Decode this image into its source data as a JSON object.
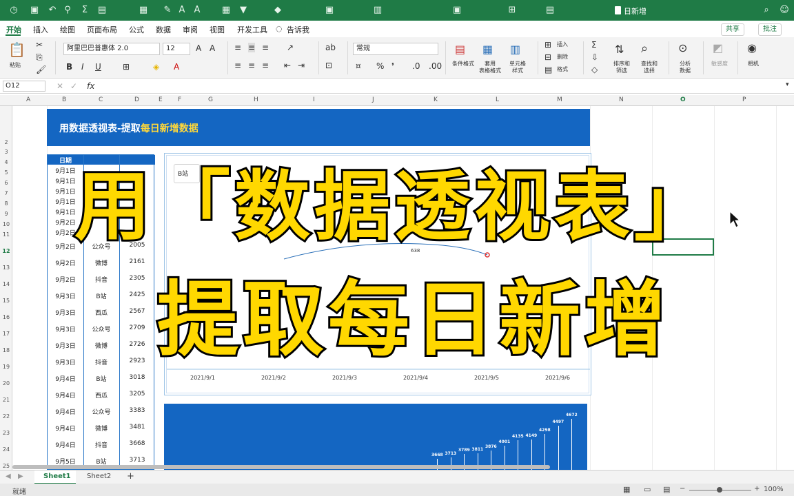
{
  "window": {
    "title": "日新增"
  },
  "tabs": [
    "开始",
    "插入",
    "绘图",
    "页面布局",
    "公式",
    "数据",
    "审阅",
    "视图",
    "开发工具",
    "告诉我"
  ],
  "top_buttons": {
    "share": "共享",
    "comment": "批注"
  },
  "ribbon": {
    "paste": "粘贴",
    "font_name": "阿里巴巴普惠体 2.0",
    "font_size": "12",
    "bold": "B",
    "italic": "I",
    "underline": "U",
    "number_format": "常规",
    "cond_format": "条件格式",
    "table_format": "套用\n表格格式",
    "cell_style": "单元格\n样式",
    "insert": "插入",
    "delete": "删除",
    "format": "格式",
    "sort_filter": "排序和\n筛选",
    "find_select": "查找和\n选择",
    "analyze": "分析\n数据",
    "sensitivity": "敏感度",
    "camera": "相机",
    "fx": "fx"
  },
  "name_box": "O12",
  "columns": [
    "A",
    "B",
    "C",
    "D",
    "E",
    "F",
    "G",
    "H",
    "I",
    "J",
    "K",
    "L",
    "M",
    "N",
    "O",
    "P"
  ],
  "rows": [
    "2",
    "3",
    "4",
    "5",
    "6",
    "7",
    "8",
    "9",
    "10",
    "11",
    "12",
    "13",
    "14",
    "15",
    "16",
    "17",
    "18",
    "19",
    "20",
    "21",
    "22",
    "23",
    "24",
    "25"
  ],
  "banner": {
    "prefix": "用数据透视表-提取",
    "highlight": "每日新增数据"
  },
  "table": {
    "header_date": "日期",
    "rows": [
      [
        "9月1日",
        "",
        ""
      ],
      [
        "9月1日",
        "",
        ""
      ],
      [
        "9月1日",
        "",
        ""
      ],
      [
        "9月1日",
        "",
        ""
      ],
      [
        "9月1日",
        "",
        ""
      ],
      [
        "9月2日",
        "",
        ""
      ],
      [
        "9月2日",
        "",
        ""
      ],
      [
        "9月2日",
        "公众号",
        "2005"
      ],
      [
        "9月2日",
        "微博",
        "2161"
      ],
      [
        "9月2日",
        "抖音",
        "2305"
      ],
      [
        "9月3日",
        "B站",
        "2425"
      ],
      [
        "9月3日",
        "西瓜",
        "2567"
      ],
      [
        "9月3日",
        "公众号",
        "2709"
      ],
      [
        "9月3日",
        "微博",
        "2726"
      ],
      [
        "9月3日",
        "抖音",
        "2923"
      ],
      [
        "9月4日",
        "B站",
        "3018"
      ],
      [
        "9月4日",
        "西瓜",
        "3205"
      ],
      [
        "9月4日",
        "公众号",
        "3383"
      ],
      [
        "9月4日",
        "微博",
        "3481"
      ],
      [
        "9月4日",
        "抖音",
        "3668"
      ],
      [
        "9月5日",
        "B站",
        "3713"
      ]
    ]
  },
  "chart1": {
    "filter_label": "B站",
    "point_label": "638",
    "x_labels": [
      "2021/9/1",
      "2021/9/2",
      "2021/9/3",
      "2021/9/4",
      "2021/9/5",
      "2021/9/6"
    ]
  },
  "chart2": {
    "labels": [
      "3668",
      "3713",
      "3789",
      "3811",
      "3876",
      "4001",
      "4135",
      "4149",
      "4298",
      "4497",
      "4672"
    ]
  },
  "overlay": {
    "line1": "用「数据透视表」",
    "line2": "提取每日新增"
  },
  "sheets": [
    "Sheet1",
    "Sheet2"
  ],
  "status": {
    "ready": "就绪",
    "zoom": "100%"
  }
}
